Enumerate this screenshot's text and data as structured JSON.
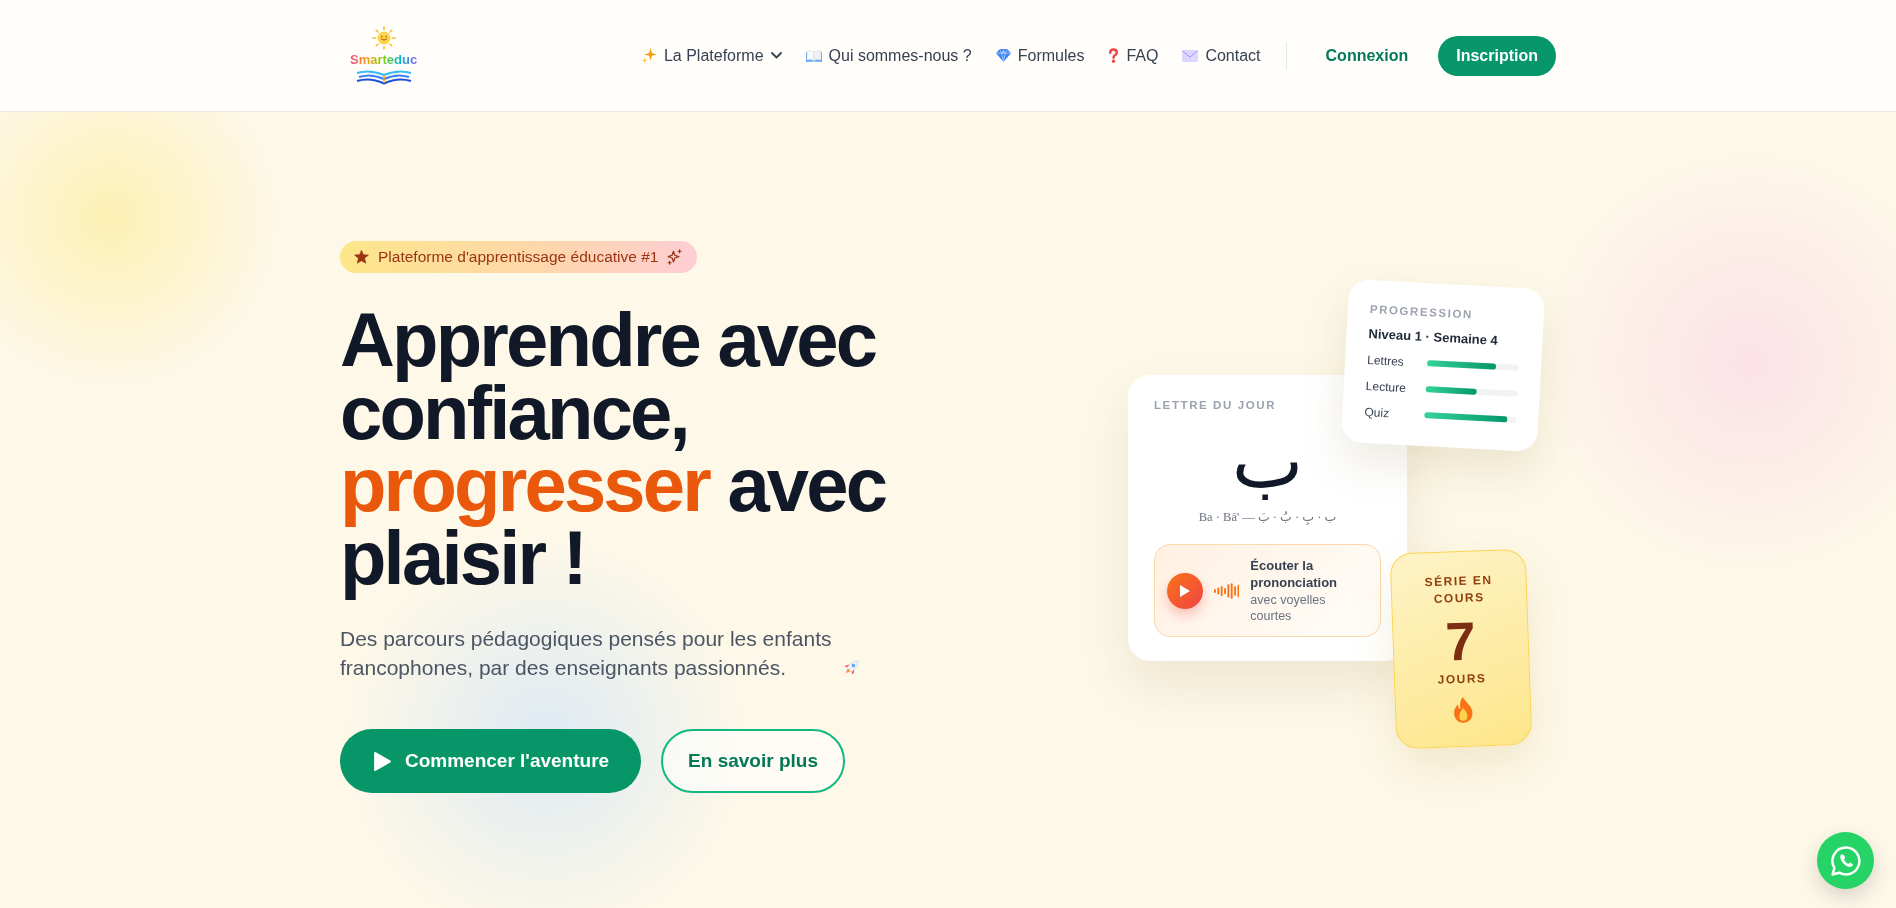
{
  "header": {
    "logo_text": "Smarteduc",
    "nav": [
      {
        "kind": "dropdown",
        "label": "La Plateforme"
      },
      {
        "kind": "link",
        "label": "Qui sommes-nous ?"
      },
      {
        "kind": "link",
        "label": "Formules"
      },
      {
        "kind": "link",
        "label": "FAQ"
      },
      {
        "kind": "link",
        "label": "Contact"
      }
    ],
    "login": "Connexion",
    "signup": "Inscription"
  },
  "hero": {
    "badge": "Plateforme d'apprentissage éducative #1",
    "title": [
      {
        "text": "Apprendre avec confiance,",
        "highlight": false
      },
      {
        "text": "progresser",
        "highlight": true
      },
      {
        "text": "avec plaisir !",
        "highlight": false
      }
    ],
    "subtitle": "Des parcours pédagogiques pensés pour les enfants francophones, par des enseignants passionnés.",
    "primary_button": "Commencer l'aventure",
    "secondary_button": "En savoir plus"
  },
  "letter_card": {
    "label": "LETTRE DU JOUR",
    "letter": "ب",
    "transliteration": "Ba · Bā' — ب · بِ · بُ · بَ",
    "audio": {
      "title": "Écouter la prononciation",
      "subtitle": "avec voyelles courtes"
    }
  },
  "progress_card": {
    "label": "PROGRESSION",
    "level_text": "Niveau 1 · Semaine 4",
    "rows": [
      {
        "label": "Lettres",
        "level": 0.75
      },
      {
        "label": "Lecture",
        "level": 0.55
      },
      {
        "label": "Quiz",
        "level": 0.9
      }
    ]
  },
  "streak_card": {
    "label": "SÉRIE EN COURS",
    "count": "7",
    "unit": "JOURS"
  }
}
